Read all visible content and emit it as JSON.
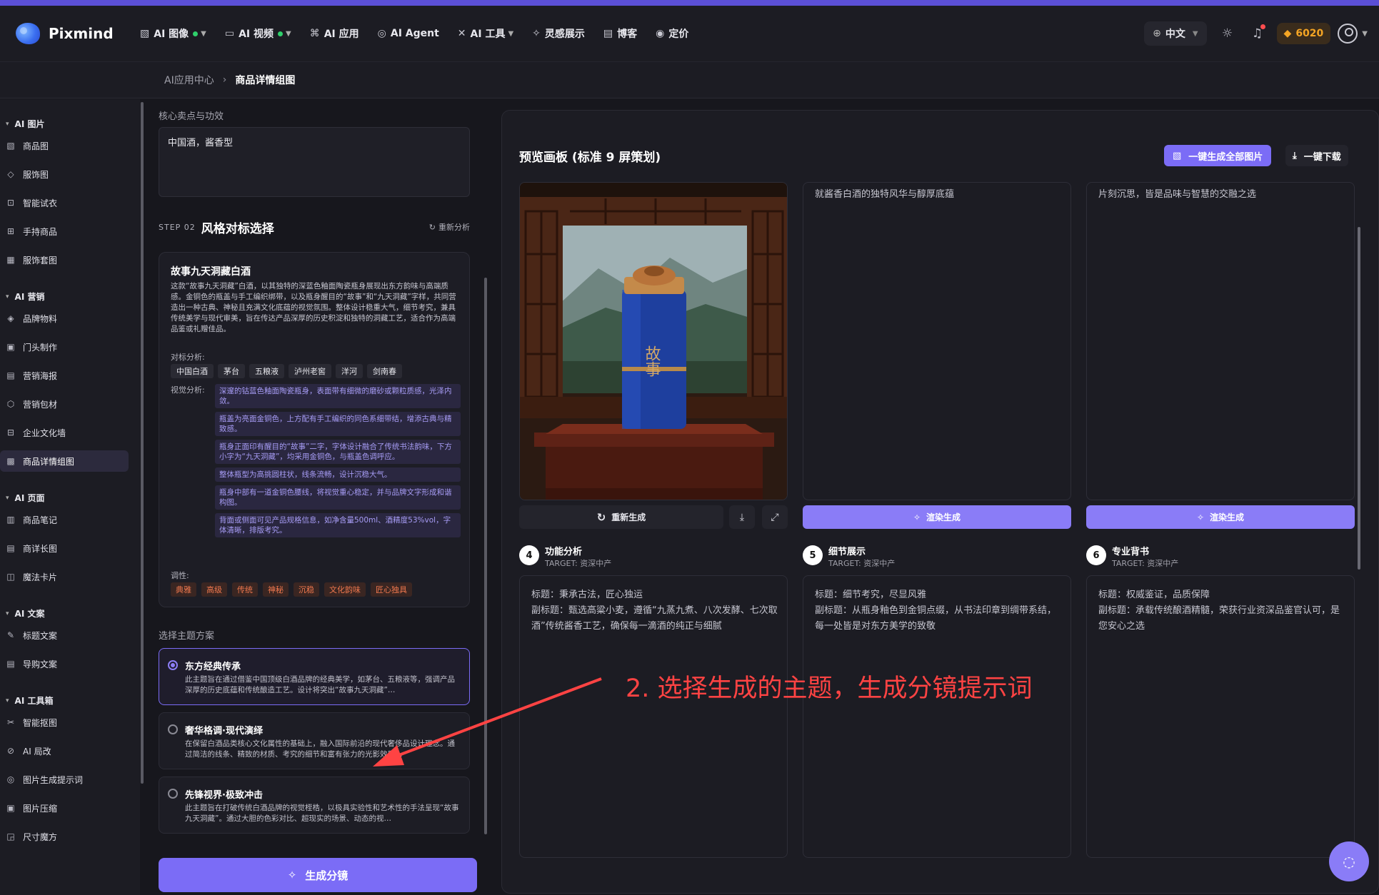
{
  "header": {
    "brand": "Pixmind",
    "nav": [
      {
        "icon": "image-icon",
        "glyph": "▧",
        "label": "AI 图像",
        "dot": true,
        "caret": true
      },
      {
        "icon": "video-icon",
        "glyph": "▭",
        "label": "AI 视频",
        "dot": true,
        "caret": true
      },
      {
        "icon": "apps-icon",
        "glyph": "⌘",
        "label": "AI 应用",
        "dot": false,
        "caret": false
      },
      {
        "icon": "agent-icon",
        "glyph": "◎",
        "label": "AI Agent",
        "dot": false,
        "caret": false
      },
      {
        "icon": "tools-icon",
        "glyph": "✕",
        "label": "AI 工具",
        "dot": false,
        "caret": true
      },
      {
        "icon": "sparkle-icon",
        "glyph": "✧",
        "label": "灵感展示",
        "dot": false,
        "caret": false
      },
      {
        "icon": "blog-icon",
        "glyph": "▤",
        "label": "博客",
        "dot": false,
        "caret": false
      },
      {
        "icon": "pricing-icon",
        "glyph": "◉",
        "label": "定价",
        "dot": false,
        "caret": false
      }
    ],
    "language": "中文",
    "points": "6020"
  },
  "breadcrumb": {
    "parent": "AI应用中心",
    "current": "商品详情组图"
  },
  "sidebar": {
    "groups": [
      {
        "label": "AI 图片",
        "items": [
          "商品图",
          "服饰图",
          "智能试衣",
          "手持商品",
          "服饰套图"
        ]
      },
      {
        "label": "AI 营销",
        "items": [
          "品牌物料",
          "门头制作",
          "营销海报",
          "营销包材",
          "企业文化墙",
          "商品详情组图"
        ]
      },
      {
        "label": "AI 页面",
        "items": [
          "商品笔记",
          "商详长图",
          "魔法卡片"
        ]
      },
      {
        "label": "AI 文案",
        "items": [
          "标题文案",
          "导购文案"
        ]
      },
      {
        "label": "AI 工具箱",
        "items": [
          "智能抠图",
          "AI 局改",
          "图片生成提示词",
          "图片压缩",
          "尺寸魔方"
        ]
      }
    ],
    "active": "商品详情组图"
  },
  "form": {
    "selling_points_label": "核心卖点与功效",
    "selling_points_value": "中国酒，酱香型",
    "step_tag": "STEP 02",
    "step_title": "风格对标选择",
    "reanalyze": "重新分析",
    "style_card": {
      "title": "故事九天洞藏白酒",
      "desc": "这款“故事九天洞藏”白酒，以其独特的深蓝色釉面陶瓷瓶身展现出东方韵味与高端质感。金铜色的瓶盖与手工编织绑带，以及瓶身醒目的“故事”和“九天洞藏”字样，共同营造出一种古典、神秘且充满文化底蕴的视觉氛围。整体设计稳重大气，细节考究，兼具传统美学与现代审美，旨在传达产品深厚的历史积淀和独特的洞藏工艺，适合作为高端品鉴或礼赠佳品。",
      "benchmark_label": "对标分析:",
      "benchmarks": [
        "中国白酒",
        "茅台",
        "五粮液",
        "泸州老窖",
        "洋河",
        "剑南春"
      ],
      "visual_label": "视觉分析:",
      "visual": [
        "深邃的钴蓝色釉面陶瓷瓶身，表面带有细微的磨砂或颗粒质感，光泽内敛。",
        "瓶盖为亮面金铜色，上方配有手工编织的同色系细带结，增添古典与精致感。",
        "瓶身正面印有醒目的“故事”二字，字体设计融合了传统书法韵味，下方小字为“九天洞藏”，均采用金铜色，与瓶盖色调呼应。",
        "整体瓶型为高挑圆柱状，线条流畅，设计沉稳大气。",
        "瓶身中部有一道金铜色腰线，将视觉重心稳定，并与品牌文字形成和谐构图。",
        "背面或侧面可见产品规格信息，如净含量500ml、酒精度53%vol，字体清晰，排版考究。"
      ],
      "tone_label": "调性:",
      "tones": [
        "典雅",
        "高级",
        "传统",
        "神秘",
        "沉稳",
        "文化韵味",
        "匠心独具"
      ]
    },
    "theme_label": "选择主题方案",
    "themes": [
      {
        "title": "东方经典传承",
        "desc": "此主题旨在通过借鉴中国顶级白酒品牌的经典美学，如茅台、五粮液等，强调产品深厚的历史底蕴和传统酿造工艺。设计将突出“故事九天洞藏”…",
        "selected": true
      },
      {
        "title": "奢华格调·现代演绎",
        "desc": "在保留白酒品类核心文化属性的基础上，融入国际前沿的现代奢侈品设计理念。通过简洁的线条、精致的材质、考究的细节和富有张力的光影效果…",
        "selected": false
      },
      {
        "title": "先锋视界·极致冲击",
        "desc": "此主题旨在打破传统白酒品牌的视觉桎梏，以极具实验性和艺术性的手法呈现“故事九天洞藏”。通过大胆的色彩对比、超现实的场景、动态的视…",
        "selected": false
      }
    ],
    "generate_button": "生成分镜"
  },
  "preview": {
    "title": "预览画板 (标准 9 屏策划)",
    "generate_all": "一键生成全部图片",
    "download_all": "一键下载",
    "frame_texts": [
      "就酱香白酒的独特风华与醇厚底蕴",
      "片刻沉思，皆是品味与智慧的交融之选"
    ],
    "bottle_label": "故事",
    "regenerate": "重新生成",
    "render": "渲染生成",
    "scenes": [
      {
        "num": "4",
        "title": "功能分析",
        "target": "TARGET: 资深中产",
        "text": "标题：秉承古法，匠心独运\n副标题：甄选高粱小麦，遵循“九蒸九煮、八次发酵、七次取酒”传统酱香工艺，确保每一滴酒的纯正与细腻"
      },
      {
        "num": "5",
        "title": "细节展示",
        "target": "TARGET: 资深中产",
        "text": "标题：细节考究，尽显风雅\n副标题：从瓶身釉色到金铜点缀，从书法印章到绸带系结，每一处皆是对东方美学的致敬"
      },
      {
        "num": "6",
        "title": "专业背书",
        "target": "TARGET: 资深中产",
        "text": "标题：权威鉴证，品质保障\n副标题：承载传统酿酒精髓，荣获行业资深品鉴官认可，是您安心之选"
      }
    ]
  },
  "annotation": "2. 选择生成的主题，生成分镜提示词",
  "colors": {
    "accent": "#7b6cf6",
    "annotation": "#ff4343",
    "points": "#f5a524"
  }
}
